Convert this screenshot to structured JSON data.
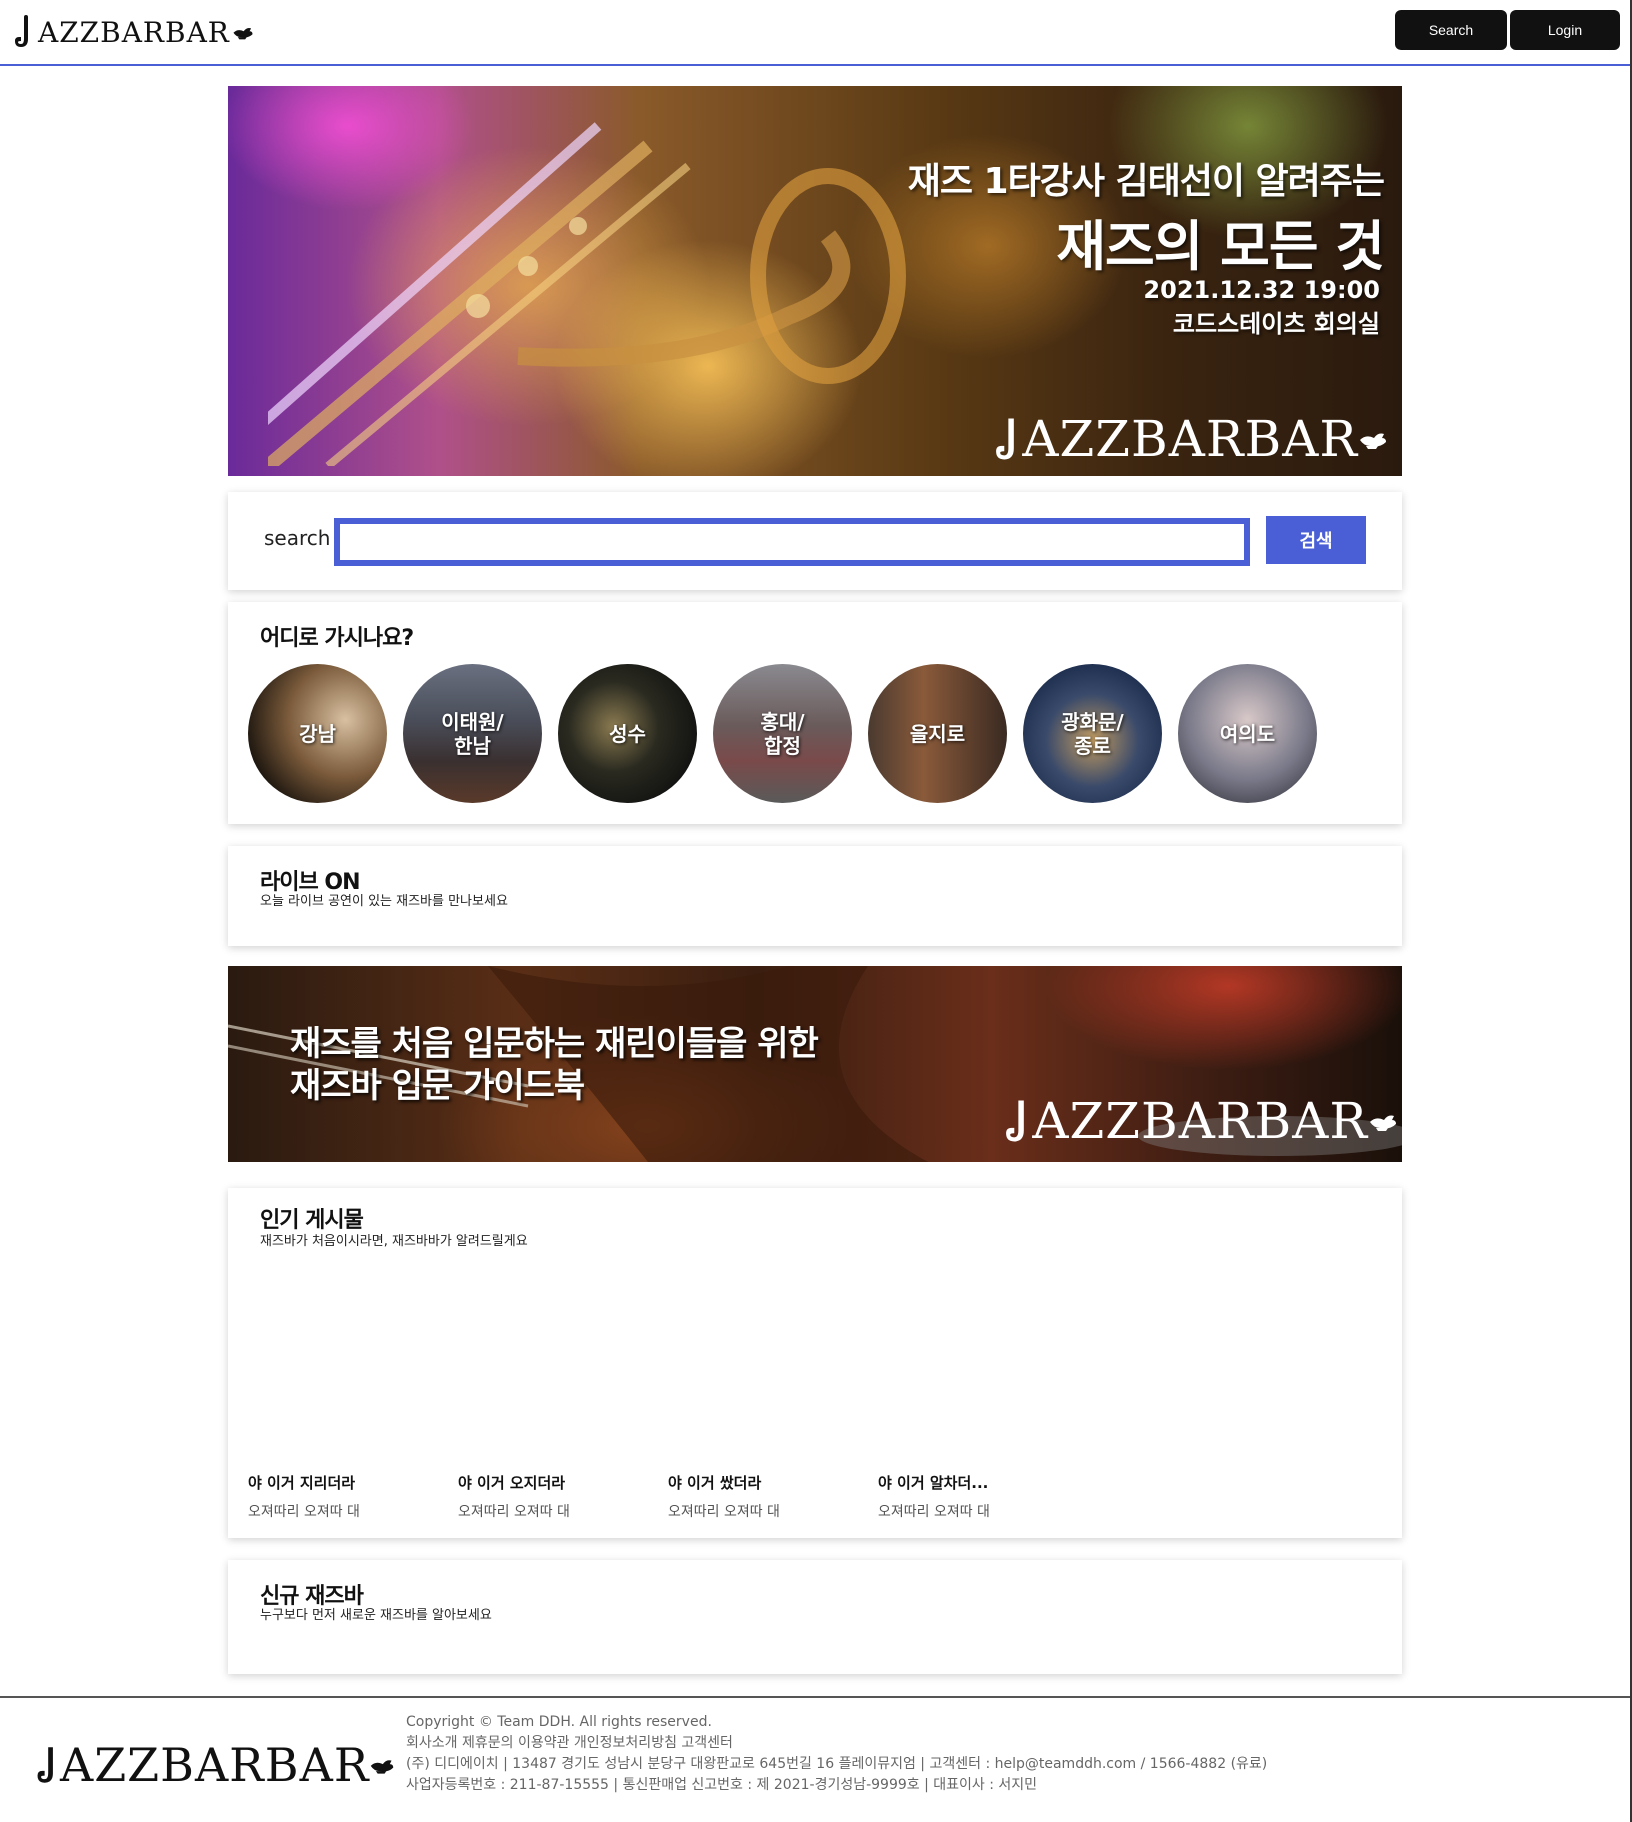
{
  "header": {
    "logo_text": "AZZBARBAR",
    "search_button": "Search",
    "login_button": "Login"
  },
  "hero": {
    "line1": "재즈 1타강사 김태선이 알려주는",
    "line2": "재즈의 모든 것",
    "date": "2021.12.32 19:00",
    "place": "코드스테이츠 회의실",
    "logo_text": "AZZBARBAR"
  },
  "search": {
    "label": "search",
    "value": "",
    "placeholder": "",
    "submit_label": "검색"
  },
  "regions": {
    "title": "어디로 가시나요?",
    "items": [
      {
        "label": "강남"
      },
      {
        "label": "이태원/\n한남"
      },
      {
        "label": "성수"
      },
      {
        "label": "홍대/\n합정"
      },
      {
        "label": "을지로"
      },
      {
        "label": "광화문/\n종로"
      },
      {
        "label": "여의도"
      }
    ]
  },
  "live": {
    "title": "라이브 ON",
    "subtitle": "오늘 라이브 공연이 있는 재즈바를 만나보세요"
  },
  "guide": {
    "line1": "재즈를 처음 입문하는 재린이들을 위한",
    "line2": "재즈바 입문 가이드북",
    "logo_text": "AZZBARBAR"
  },
  "popular": {
    "title": "인기 게시물",
    "subtitle": "재즈바가 처음이시라면, 재즈바바가 알려드릴게요",
    "posts": [
      {
        "title": "야 이거 지리더라",
        "desc": "오져따리 오져따 대"
      },
      {
        "title": "야 이거 오지더라",
        "desc": "오져따리 오져따 대"
      },
      {
        "title": "야 이거 쌌더라",
        "desc": "오져따리 오져따 대"
      },
      {
        "title": "야 이거 알차더...",
        "desc": "오져따리 오져따 대"
      }
    ]
  },
  "new_bars": {
    "title": "신규 재즈바",
    "subtitle": "누구보다 먼저 새로운 재즈바를 알아보세요"
  },
  "footer": {
    "logo_text": "AZZBARBAR",
    "lines": [
      "Copyright © Team DDH. All rights reserved.",
      "회사소개 제휴문의 이용약관 개인정보처리방침 고객센터",
      "(주) 디디에이치 | 13487 경기도 성남시 분당구 대왕판교로 645번길 16 플레이뮤지엄 | 고객센터 : help@teamddh.com / 1566-4882 (유료)",
      "사업자등록번호 : 211-87-15555 | 통신판매업 신고번호 : 제 2021-경기성남-9999호 | 대표이사 : 서지민"
    ]
  },
  "colors": {
    "accent": "#4a5fd6",
    "header_button_bg": "#111111"
  }
}
